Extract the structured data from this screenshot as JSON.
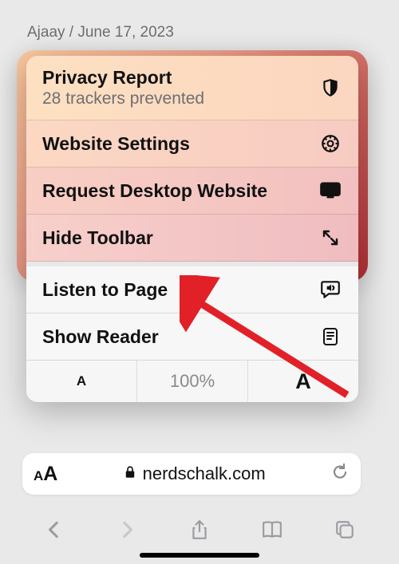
{
  "byline": "Ajaay / June 17, 2023",
  "menu": {
    "privacy": {
      "title": "Privacy Report",
      "subtitle": "28 trackers prevented"
    },
    "website_settings": "Website Settings",
    "request_desktop": "Request Desktop Website",
    "hide_toolbar": "Hide Toolbar",
    "listen": "Listen to Page",
    "show_reader": "Show Reader",
    "zoom_pct": "100%"
  },
  "addressbar": {
    "domain": "nerdschalk.com"
  },
  "annotation": {
    "color": "#e22028"
  }
}
